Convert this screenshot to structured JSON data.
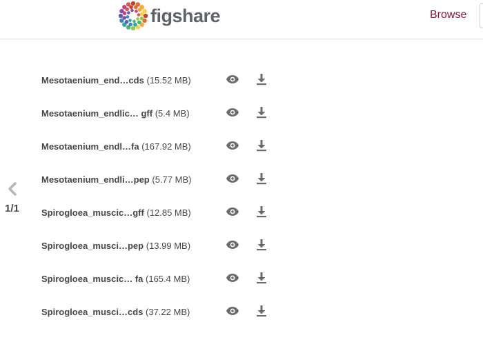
{
  "header": {
    "logo_text": "figshare",
    "browse_label": "Browse"
  },
  "pager": {
    "label": "1/1",
    "prev_icon": "chevron-left-icon"
  },
  "colors": {
    "accent": "#8a1538",
    "text": "#464646",
    "icon": "#6b6b6b"
  },
  "files": [
    {
      "name": "Mesotaenium_end…",
      "ext": "cds",
      "size": "(15.52 MB)"
    },
    {
      "name": "Mesotaenium_endlic…",
      "ext": " gff",
      "size": "(5.4 MB)"
    },
    {
      "name": "Mesotaenium_endl…",
      "ext": "fa",
      "size": "(167.92 MB)"
    },
    {
      "name": "Mesotaenium_endli…",
      "ext": "pep",
      "size": "(5.77 MB)"
    },
    {
      "name": "Spirogloea_muscic…",
      "ext": "gff",
      "size": "(12.85 MB)"
    },
    {
      "name": "Spirogloea_musci…",
      "ext": "pep",
      "size": "(13.99 MB)"
    },
    {
      "name": "Spirogloea_muscic…",
      "ext": " fa",
      "size": "(165.4 MB)"
    },
    {
      "name": "Spirogloea_musci…",
      "ext": "cds",
      "size": "(37.22 MB)"
    }
  ],
  "row_icons": {
    "view": "eye-icon",
    "download": "download-icon"
  }
}
